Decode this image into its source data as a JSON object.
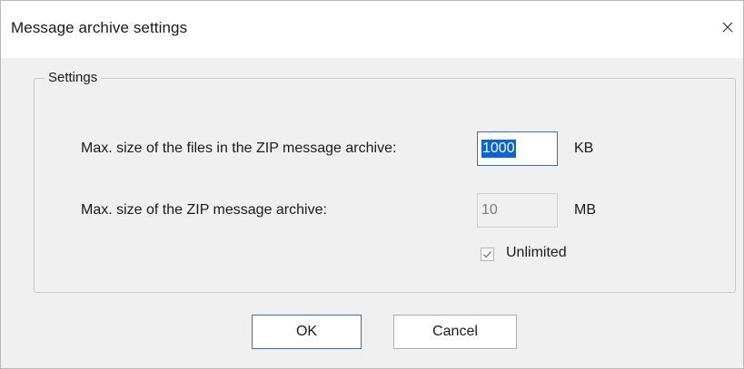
{
  "window": {
    "title": "Message archive settings"
  },
  "icons": {
    "close": "close-icon",
    "check": "checkmark-icon"
  },
  "group": {
    "label": "Settings"
  },
  "max_file_size": {
    "label": "Max. size of the files in the ZIP message archive:",
    "value": "1000",
    "unit": "KB",
    "selected": true
  },
  "max_archive_size": {
    "label": "Max. size of the ZIP message archive:",
    "value": "10",
    "unit": "MB",
    "disabled": true
  },
  "unlimited": {
    "label": "Unlimited",
    "checked": true
  },
  "buttons": {
    "ok": "OK",
    "cancel": "Cancel"
  },
  "colors": {
    "accent": "#2b72d6",
    "selection": "#0a64d8",
    "dialog_bg": "#f0f0f0"
  }
}
